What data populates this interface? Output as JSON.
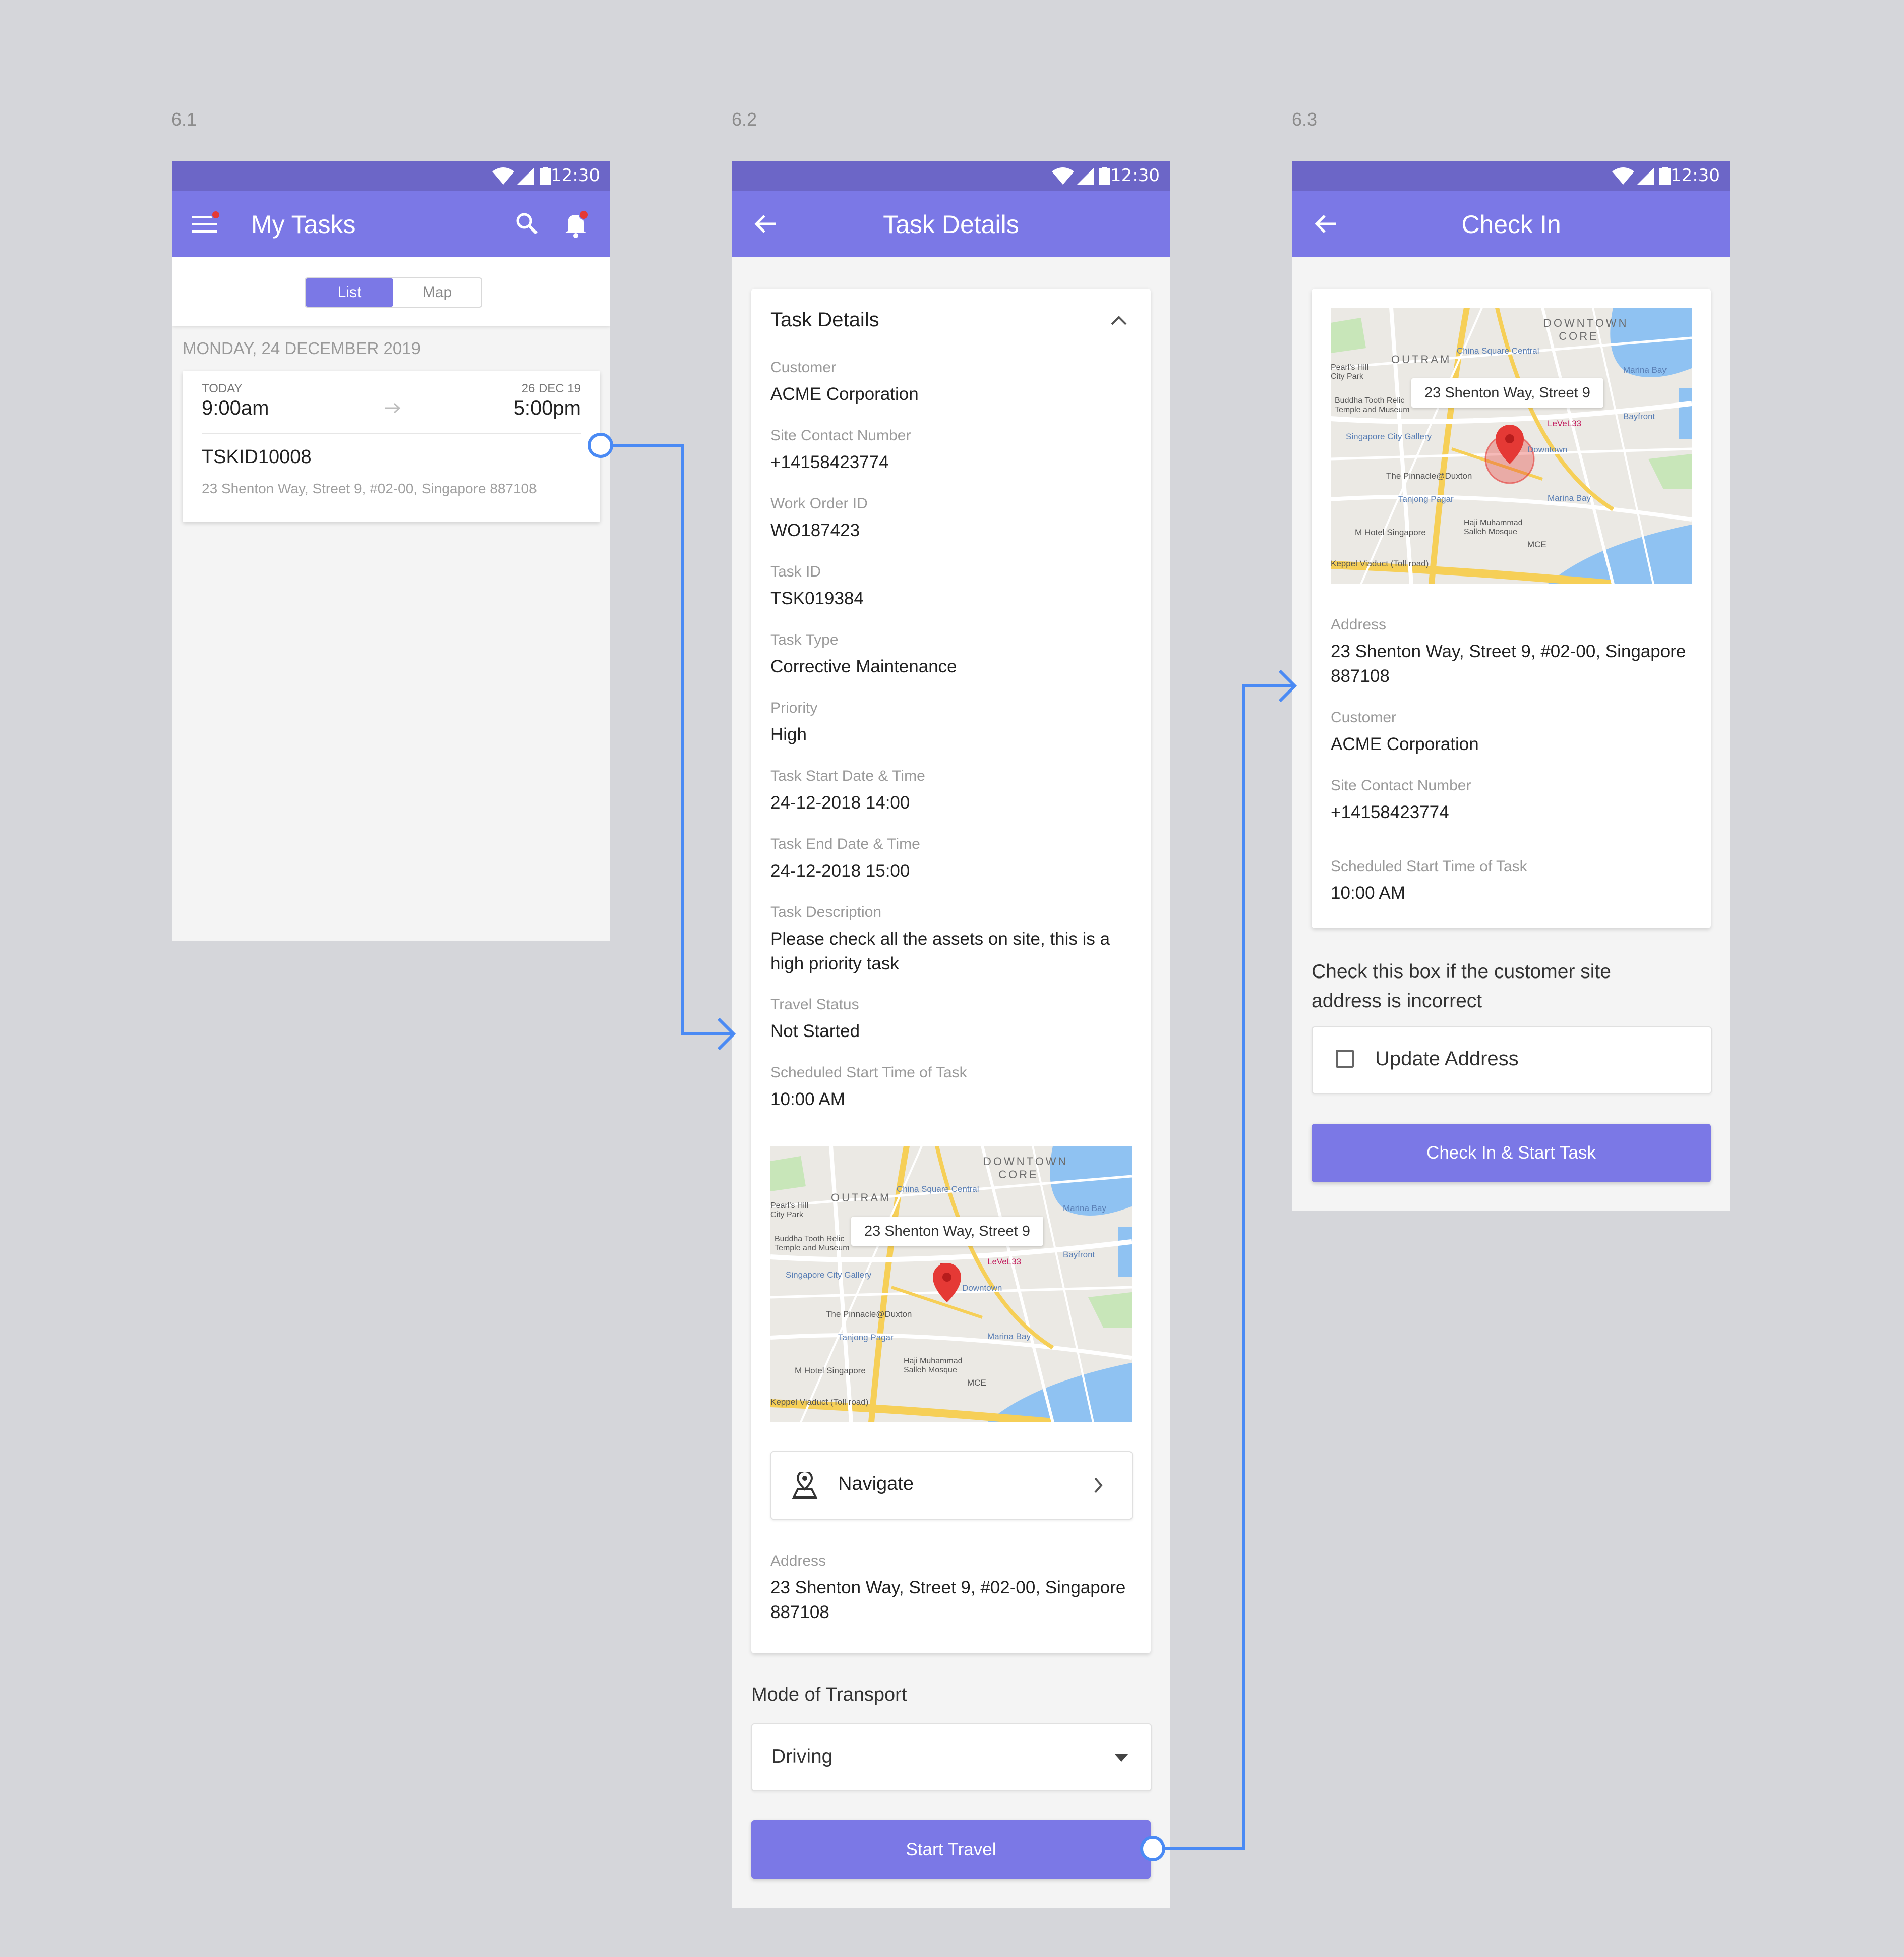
{
  "screens": {
    "s1": {
      "number": "6.1",
      "time": "12:30",
      "title": "My Tasks",
      "segments": [
        "List",
        "Map"
      ],
      "date_header": "MONDAY, 24 DECEMBER 2019",
      "task": {
        "start_label": "TODAY",
        "start_time": "9:00am",
        "end_label": "26 DEC 19",
        "end_time": "5:00pm",
        "id": "TSKID10008",
        "address": "23 Shenton Way, Street 9, #02-00, Singapore 887108"
      }
    },
    "s2": {
      "number": "6.2",
      "time": "12:30",
      "title": "Task Details",
      "card_title": "Task Details",
      "fields": [
        {
          "label": "Customer",
          "value": "ACME Corporation"
        },
        {
          "label": "Site Contact Number",
          "value": "+14158423774"
        },
        {
          "label": "Work Order ID",
          "value": "WO187423"
        },
        {
          "label": "Task ID",
          "value": "TSK019384"
        },
        {
          "label": "Task Type",
          "value": "Corrective Maintenance"
        },
        {
          "label": "Priority",
          "value": "High"
        },
        {
          "label": "Task Start Date & Time",
          "value": "24-12-2018 14:00"
        },
        {
          "label": "Task End Date & Time",
          "value": "24-12-2018 15:00"
        },
        {
          "label": "Task Description",
          "value": "Please check all the assets on site, this is a high priority task"
        },
        {
          "label": "Travel Status",
          "value": "Not Started"
        },
        {
          "label": "Scheduled Start Time of Task",
          "value": "10:00 AM"
        }
      ],
      "map_callout": "23 Shenton Way, Street 9",
      "navigate_label": "Navigate",
      "address_label": "Address",
      "address_value": "23 Shenton Way, Street 9, #02-00, Singapore 887108",
      "transport_heading": "Mode of Transport",
      "transport_value": "Driving",
      "start_button": "Start Travel"
    },
    "s3": {
      "number": "6.3",
      "time": "12:30",
      "title": "Check In",
      "map_callout": "23 Shenton Way, Street 9",
      "fields": [
        {
          "label": "Address",
          "value": "23 Shenton Way, Street 9, #02-00, Singapore 887108"
        },
        {
          "label": "Customer",
          "value": "ACME Corporation"
        },
        {
          "label": "Site Contact Number",
          "value": "+14158423774"
        },
        {
          "label": "Scheduled Start Time of Task",
          "value": "10:00 AM"
        }
      ],
      "checkbox_prompt": "Check this box if the customer site address is incorrect",
      "checkbox_label": "Update Address",
      "checkin_button": "Check In & Start Task"
    }
  },
  "map_labels": {
    "downtown": "DOWNTOWN CORE",
    "outram": "OUTRAM",
    "china_square": "China Square Central",
    "marina_bay": "Marina Bay",
    "buddha": "Buddha Tooth Relic Temple and Museum",
    "singapore_city_gallery": "Singapore City Gallery",
    "pinnacle": "The Pinnacle@Duxton",
    "tanjong_pagar": "Tanjong Pagar",
    "hotel": "M Hotel Singapore",
    "mosque": "Haji Muhammad Salleh Mosque",
    "viaduct": "Keppel Viaduct (Toll road)",
    "level33": "LeVeL33",
    "bayfront": "Bayfront",
    "downtown_stn": "Downtown",
    "pearls_hill": "Pearl's Hill City Park",
    "mce": "MCE",
    "shenton": "Shenton Way"
  },
  "colors": {
    "statusbar": "#6c66c7",
    "appbar": "#7b78e6",
    "accent": "#7b78e6",
    "flow_line": "#4a8af4",
    "notification_dot": "#e53935"
  },
  "icons": [
    "menu-icon",
    "search-icon",
    "bell-icon",
    "back-arrow-icon",
    "chevron-up-icon",
    "map-pin-icon",
    "navigate-pin-icon",
    "chevron-right-icon",
    "dropdown-caret-icon",
    "checkbox-icon",
    "wifi-icon",
    "signal-icon",
    "battery-icon"
  ]
}
